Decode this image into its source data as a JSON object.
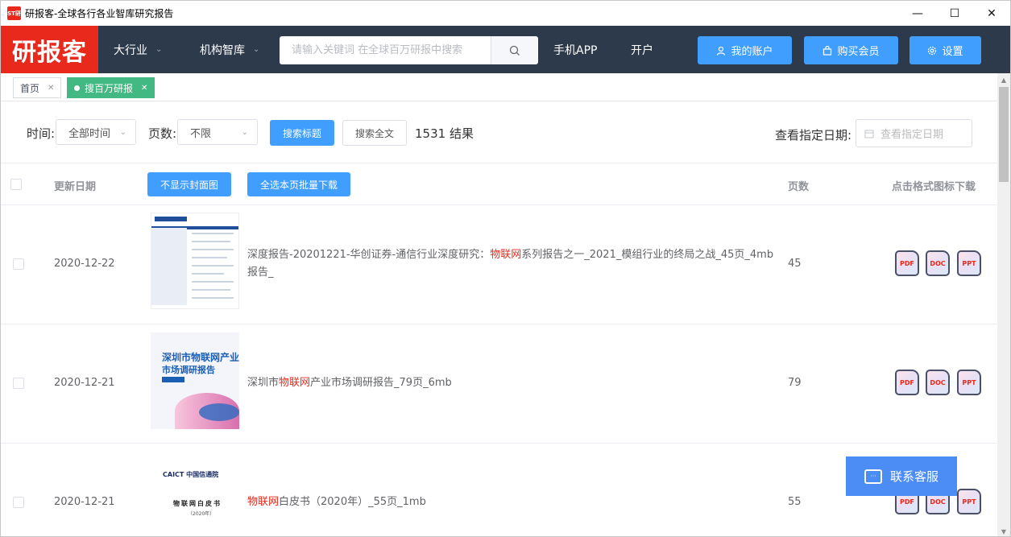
{
  "window": {
    "title": "研报客-全球各行各业智库研究报告",
    "app_icon_text": "ST研",
    "minimize": "—",
    "maximize": "☐",
    "close": "✕"
  },
  "header": {
    "logo": "研报客",
    "nav": [
      {
        "label": "大行业"
      },
      {
        "label": "机构智库"
      }
    ],
    "search_placeholder": "请输入关键词 在全球百万研报中搜索",
    "links": [
      "手机APP",
      "开户"
    ],
    "buttons": [
      {
        "label": "我的账户",
        "icon": "user-icon"
      },
      {
        "label": "购买会员",
        "icon": "bag-icon"
      },
      {
        "label": "设置",
        "icon": "gear-icon"
      }
    ]
  },
  "tabs": [
    {
      "label": "首页",
      "active": false
    },
    {
      "label": "搜百万研报",
      "active": true
    }
  ],
  "filter": {
    "time_label": "时间:",
    "time_value": "全部时间",
    "pages_label": "页数:",
    "pages_value": "不限",
    "search_title_btn": "搜索标题",
    "search_full_btn": "搜索全文",
    "result_count": "1531 结果",
    "date_label": "查看指定日期:",
    "date_placeholder": "查看指定日期"
  },
  "table": {
    "headers": {
      "update_date": "更新日期",
      "hide_cover_btn": "不显示封面图",
      "select_all_btn": "全选本页批量下载",
      "pages": "页数",
      "download": "点击格式图标下载"
    },
    "formats": [
      "PDF",
      "DOC",
      "PPT"
    ],
    "rows": [
      {
        "date": "2020-12-22",
        "title_pre": "深度报告-20201221-华创证券-通信行业深度研究：",
        "title_hl": "物联网",
        "title_post": "系列报告之一_2021_模组行业的终局之战_45页_4mb报告_",
        "pages": "45"
      },
      {
        "date": "2020-12-21",
        "title_pre": "深圳市",
        "title_hl": "物联网",
        "title_post": "产业市场调研报告_79页_6mb",
        "pages": "79",
        "cover_title1": "深圳市物联网产业",
        "cover_title2": "市场调研报告"
      },
      {
        "date": "2020-12-21",
        "title_pre": "",
        "title_hl": "物联网",
        "title_post": "白皮书（2020年）_55页_1mb",
        "pages": "55",
        "cover_org": "CAICT 中国信通院",
        "cover_title": "物联网白皮书",
        "cover_year": "（2020年）"
      }
    ]
  },
  "contact": {
    "label": "联系客服"
  },
  "colors": {
    "brand_red": "#e8291c",
    "header_bg": "#2d3a4b",
    "primary_blue": "#409eff",
    "tab_green": "#42b983"
  }
}
